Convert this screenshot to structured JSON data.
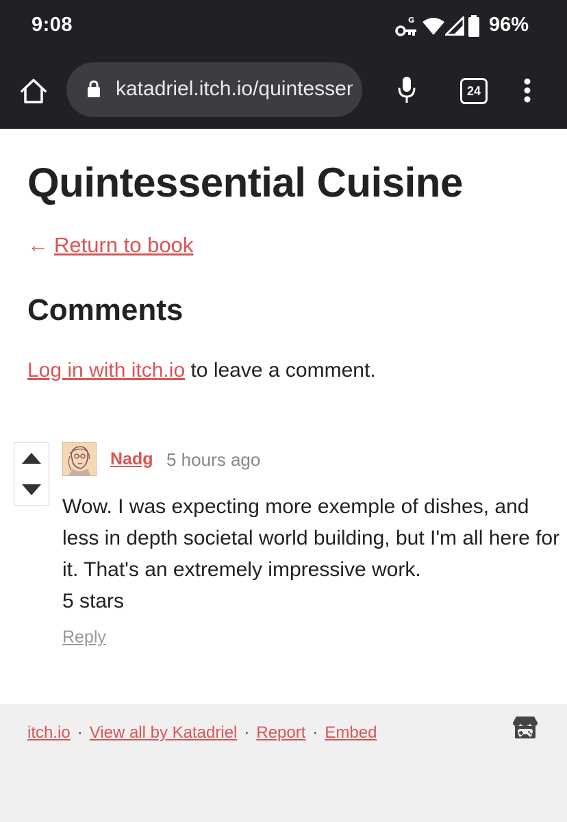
{
  "status_bar": {
    "time": "9:08",
    "battery_percent": "96%",
    "icons": [
      "vpn-key-icon",
      "wifi-icon",
      "cell-signal-icon",
      "battery-icon"
    ]
  },
  "browser": {
    "url": "katadriel.itch.io/quintessential-cuisine",
    "tab_count": "24",
    "icons": [
      "home-icon",
      "lock-icon",
      "mic-icon",
      "tabs-icon",
      "more-vert-icon"
    ]
  },
  "page": {
    "title": "Quintessential Cuisine",
    "return_arrow": "←",
    "return_link": "Return to book",
    "comments_heading": "Comments",
    "login_link": "Log in with itch.io",
    "login_suffix": " to leave a comment."
  },
  "comments": [
    {
      "author": "Nadg",
      "time": "5 hours ago",
      "body_lines": [
        "Wow. I was expecting more exemple of dishes, and less in depth societal world building, but I'm all here for it. That's an extremely impressive work.",
        "5 stars"
      ],
      "reply_label": "Reply"
    }
  ],
  "footer": {
    "links": [
      "itch.io",
      "View all by Katadriel",
      "Report",
      "Embed"
    ],
    "separator": "·"
  },
  "colors": {
    "chrome_bg": "#202124",
    "url_pill_bg": "#3c3d40",
    "link": "#da5555",
    "text": "#222222",
    "muted": "#888888",
    "footer_bg": "#f0f0f0"
  }
}
